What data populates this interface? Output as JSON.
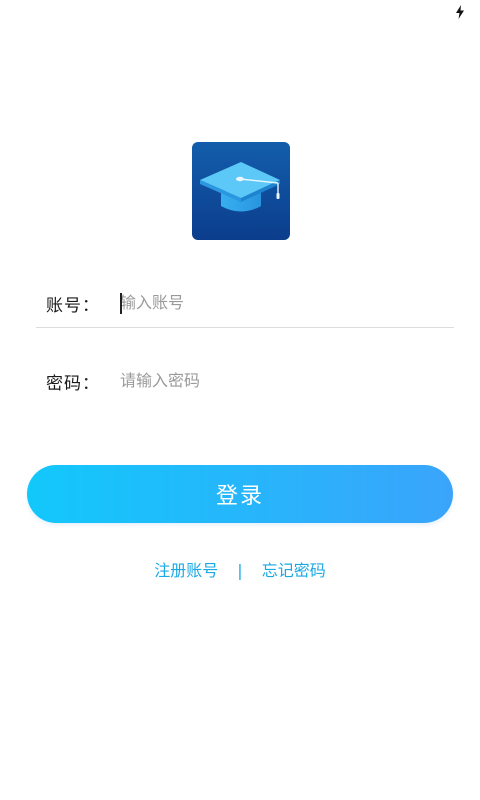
{
  "status_bar": {
    "icons": [
      "charging-bolt-icon"
    ]
  },
  "logo": {
    "icon": "graduation-cap-icon"
  },
  "form": {
    "account": {
      "label": "账号：",
      "placeholder": "输入账号",
      "value": ""
    },
    "password": {
      "label": "密码：",
      "placeholder": "请输入密码",
      "value": ""
    }
  },
  "login_button": {
    "label": "登录"
  },
  "links": {
    "register": "注册账号",
    "separator": "|",
    "forgot": "忘记密码"
  },
  "colors": {
    "accent": "#1aa9e3",
    "button_gradient_start": "#12c8fb",
    "button_gradient_end": "#3aa4fb",
    "logo_bg": "#135eac"
  }
}
